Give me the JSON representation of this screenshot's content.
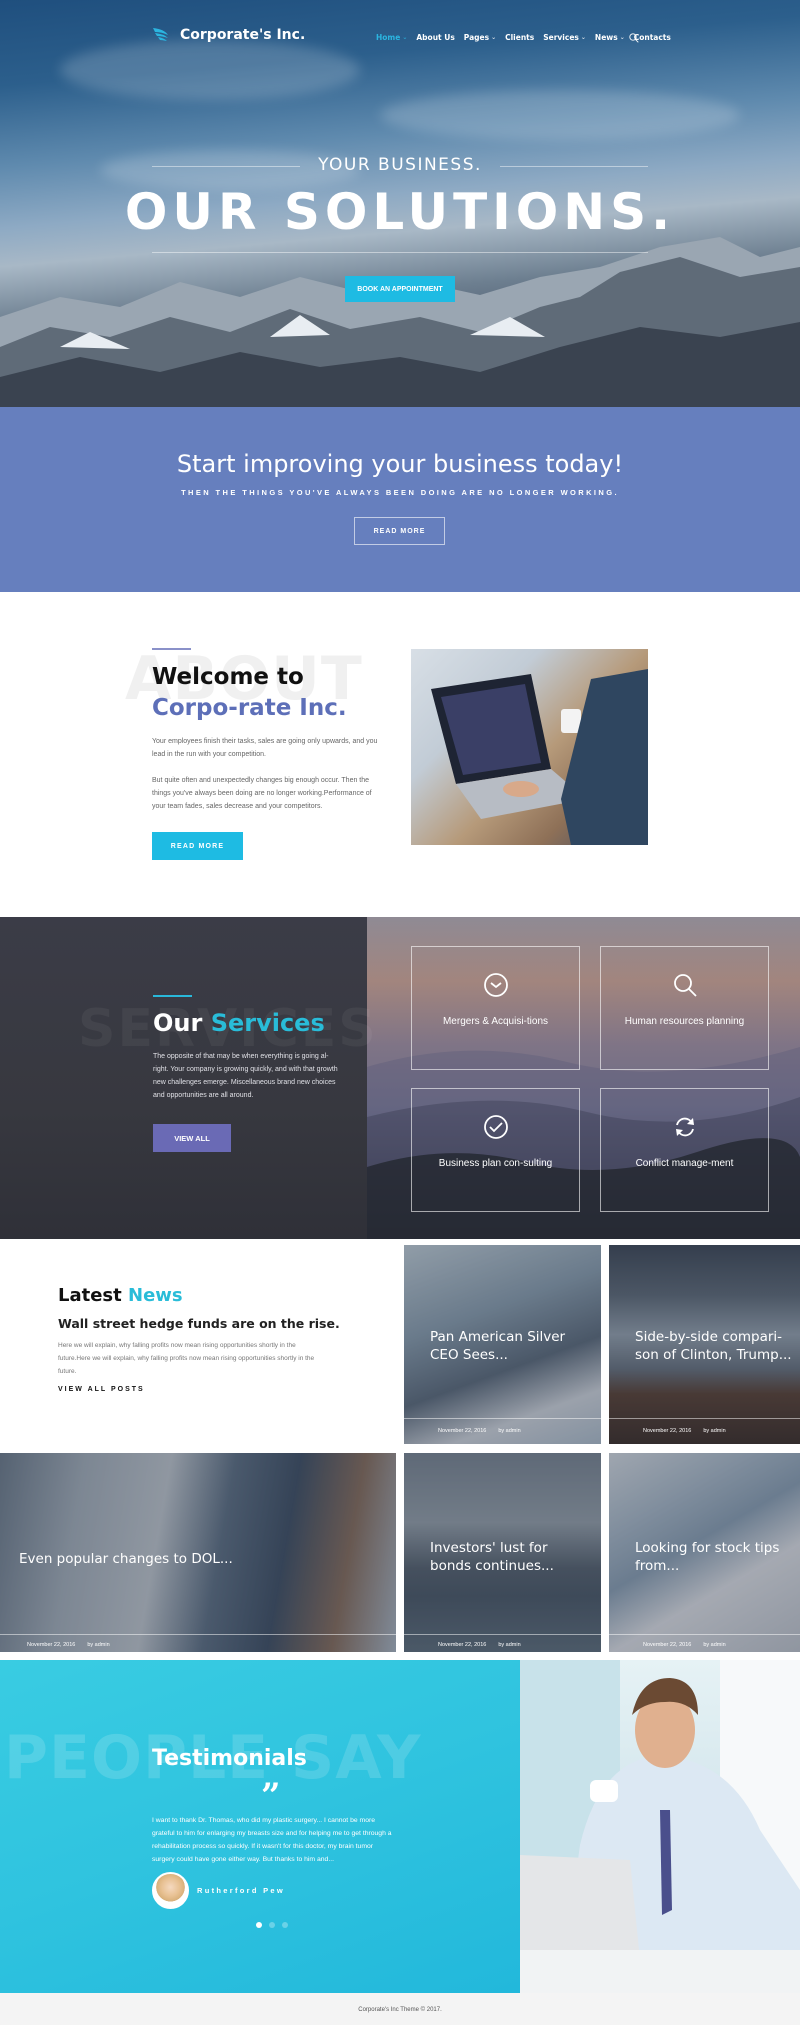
{
  "header": {
    "logo_text": "Corporate's Inc.",
    "nav": [
      {
        "label": "Home",
        "dropdown": true,
        "active": true
      },
      {
        "label": "About Us",
        "dropdown": false,
        "active": false
      },
      {
        "label": "Pages",
        "dropdown": true,
        "active": false
      },
      {
        "label": "Clients",
        "dropdown": false,
        "active": false
      },
      {
        "label": "Services",
        "dropdown": true,
        "active": false
      },
      {
        "label": "News",
        "dropdown": true,
        "active": false
      },
      {
        "label": "Contacts",
        "dropdown": false,
        "active": false
      }
    ],
    "search_icon": "search-icon"
  },
  "hero": {
    "subtitle": "YOUR BUSINESS.",
    "title": "OUR SOLUTIONS.",
    "button": "BOOK AN APPOINTMENT"
  },
  "banner": {
    "heading": "Start improving your business today!",
    "subheading": "THEN THE THINGS YOU'VE ALWAYS BEEN DOING ARE NO LONGER WORKING.",
    "button": "READ MORE"
  },
  "about": {
    "bg_word": "ABOUT",
    "title_bold": "Welcome to",
    "title_rest": "Corpo-rate Inc.",
    "paragraph1": "Your employees finish their tasks, sales are going only upwards, and you lead in the run with your competition.",
    "paragraph2": "But quite often and unexpectedly changes big enough occur. Then the things you've always been doing are no longer working.Performance of your team fades, sales decrease and your competitors.",
    "button": "READ MORE"
  },
  "services": {
    "bg_word": "SERVICES",
    "title_bold": "Our",
    "title_rest": "Services",
    "paragraph": "The opposite of that may be when everything is going al-right. Your company is growing quickly, and with that growth new challenges emerge. Miscellaneous brand new choices and opportunities are all around.",
    "button": "VIEW ALL",
    "cards": [
      {
        "label": "Mergers & Acquisi-tions",
        "icon": "clock-icon"
      },
      {
        "label": "Human resources planning",
        "icon": "search-icon"
      },
      {
        "label": "Business plan con-sulting",
        "icon": "check-circle-icon"
      },
      {
        "label": "Conflict manage-ment",
        "icon": "refresh-icon"
      }
    ]
  },
  "news": {
    "title_bold": "Latest",
    "title_rest": "News",
    "headline": "Wall street hedge funds are on the rise.",
    "paragraph": "Here we will explain, why falling profits now mean rising opportunities shortly in the future.Here we will explain, why falling profits now mean rising opportunities shortly in the future.",
    "view_all": "VIEW ALL POSTS",
    "posts": [
      {
        "title": "Pan American Silver CEO Sees...",
        "date": "November 22, 2016",
        "author": "by admin"
      },
      {
        "title": "Side-by-side compari-son of Clinton, Trump...",
        "date": "November 22, 2016",
        "author": "by admin"
      },
      {
        "title": "Even popular changes to DOL...",
        "date": "November 22, 2016",
        "author": "by admin"
      },
      {
        "title": "Investors' lust for bonds continues...",
        "date": "November 22, 2016",
        "author": "by admin"
      },
      {
        "title": "Looking for stock tips from...",
        "date": "November 22, 2016",
        "author": "by admin"
      }
    ]
  },
  "testimonials": {
    "bg_word": "PEOPLE SAY",
    "title": "Testimonials",
    "quote_mark": "”",
    "text": "I want to thank Dr. Thomas, who did my plastic surgery... I cannot be more grateful to him for enlarging my breasts size and for helping me to get through a rehabilitation process so quickly. If it wasn't for this doctor, my brain tumor surgery could have gone either way. But thanks to him and...",
    "author": "Rutherford Pew",
    "slides": 3,
    "active_slide": 1
  },
  "footer": {
    "text": "Corporate's Inc Theme © 2017."
  },
  "colors": {
    "accent_cyan": "#1ebbe3",
    "accent_purple": "#667fbe",
    "button_violet": "#6a6ab5",
    "dark": "#37383f"
  }
}
